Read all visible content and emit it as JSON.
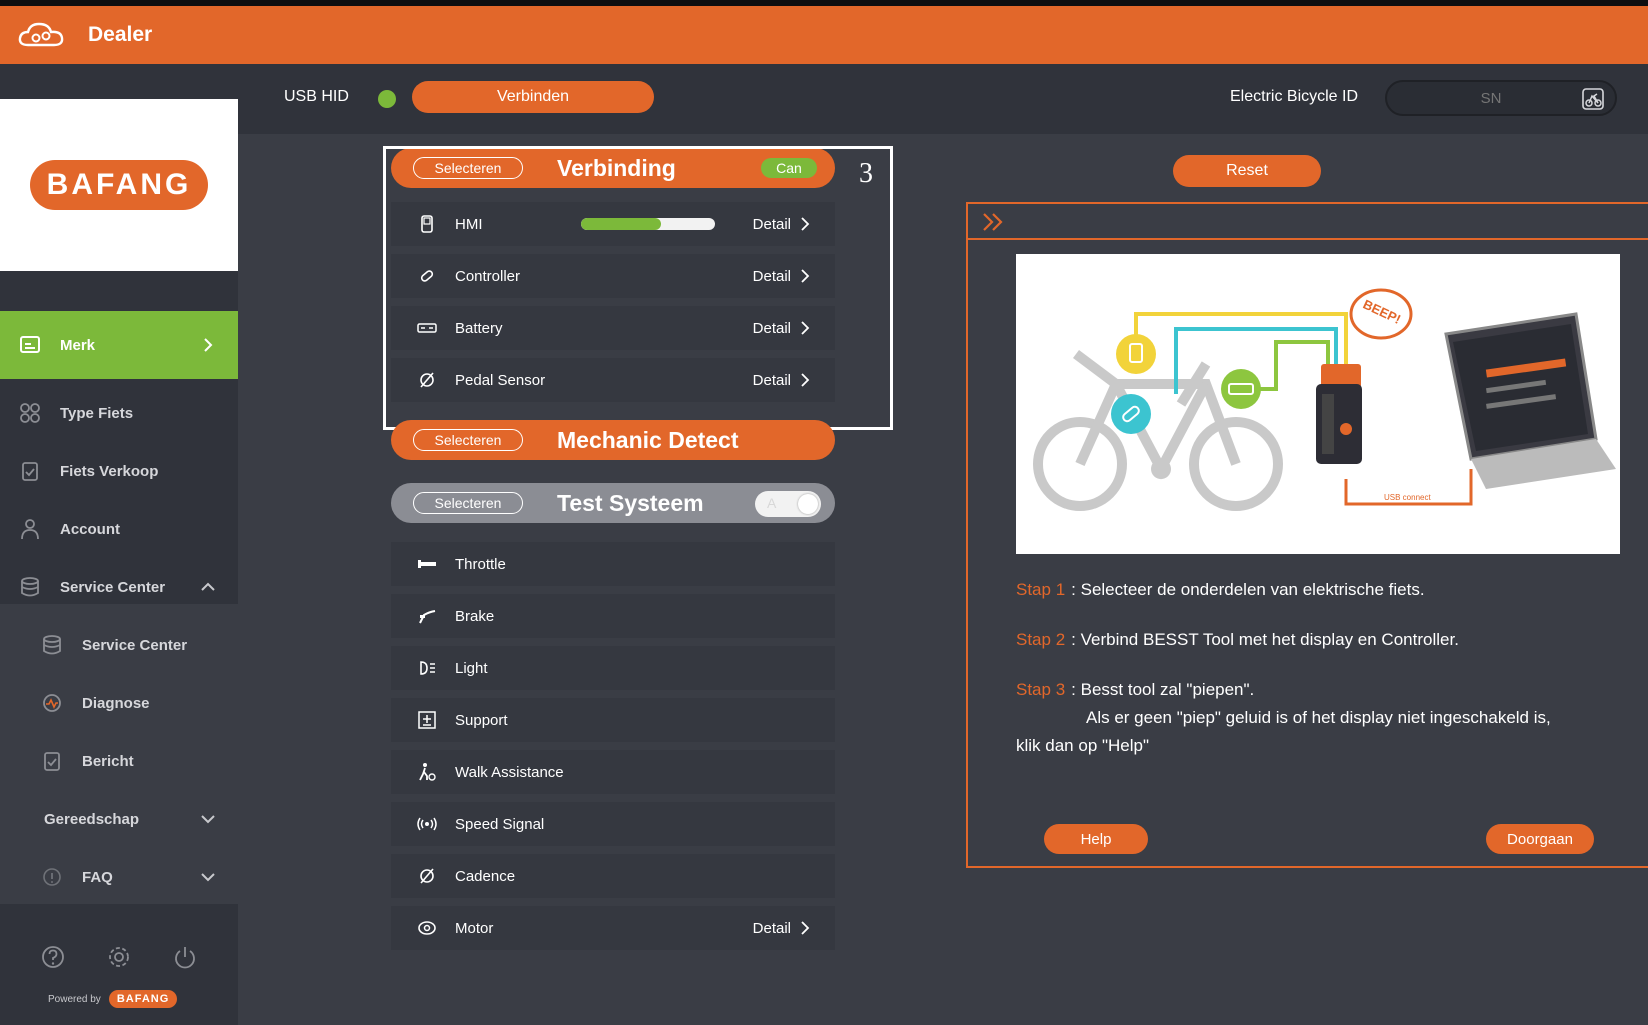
{
  "app": {
    "title": "Dealer",
    "logo": "BAFANG"
  },
  "sidebar": {
    "items": [
      {
        "label": "Merk",
        "icon": "merk-icon",
        "active": true
      },
      {
        "label": "Type Fiets",
        "icon": "grid-icon"
      },
      {
        "label": "Fiets Verkoop",
        "icon": "clipboard-icon"
      },
      {
        "label": "Account",
        "icon": "user-icon"
      },
      {
        "label": "Service Center",
        "icon": "database-icon",
        "expanded": true
      }
    ],
    "subitems": [
      {
        "label": "Service Center",
        "icon": "database-icon"
      },
      {
        "label": "Diagnose",
        "icon": "diagnose-icon"
      },
      {
        "label": "Bericht",
        "icon": "clipboard-icon"
      }
    ],
    "gereedschap": "Gereedschap",
    "faq": "FAQ",
    "powered_by": "Powered by",
    "powered_logo": "BAFANG"
  },
  "connection": {
    "usb_label": "USB HID",
    "connect_label": "Verbinden",
    "ebike_label": "Electric Bicycle ID",
    "sn_placeholder": "SN"
  },
  "panels": {
    "select_label": "Selecteren",
    "verbinding": {
      "title": "Verbinding",
      "badge": "Can",
      "rows": [
        {
          "label": "HMI",
          "detail": "Detail",
          "progress": 0.6
        },
        {
          "label": "Controller",
          "detail": "Detail"
        },
        {
          "label": "Battery",
          "detail": "Detail"
        },
        {
          "label": "Pedal Sensor",
          "detail": "Detail"
        }
      ]
    },
    "mechanic": {
      "title": "Mechanic Detect"
    },
    "test": {
      "title": "Test Systeem",
      "toggle_letter": "A",
      "rows": [
        {
          "label": "Throttle"
        },
        {
          "label": "Brake"
        },
        {
          "label": "Light"
        },
        {
          "label": "Support"
        },
        {
          "label": "Walk Assistance"
        },
        {
          "label": "Speed Signal"
        },
        {
          "label": "Cadence"
        },
        {
          "label": "Motor",
          "detail": "Detail"
        }
      ]
    }
  },
  "annotation": {
    "step_number": "3"
  },
  "help": {
    "reset_label": "Reset",
    "beep_text": "BEEP!",
    "usb_connect": "USB connect",
    "steps": [
      {
        "label": "Stap 1",
        "text": ": Selecteer de onderdelen van elektrische fiets."
      },
      {
        "label": "Stap 2",
        "text": ": Verbind BESST Tool met het display en Controller."
      },
      {
        "label": "Stap 3",
        "text": ": Besst tool zal \"piepen\"."
      }
    ],
    "step3_extra_1": "Als er geen \"piep\" geluid is of het display niet ingeschakeld is,",
    "step3_extra_2": "klik dan op \"Help\"",
    "help_label": "Help",
    "continue_label": "Doorgaan"
  },
  "colors": {
    "accent": "#e2672a",
    "active": "#7cb93a",
    "background": "#3a3d45",
    "sidebar": "#30333b"
  }
}
